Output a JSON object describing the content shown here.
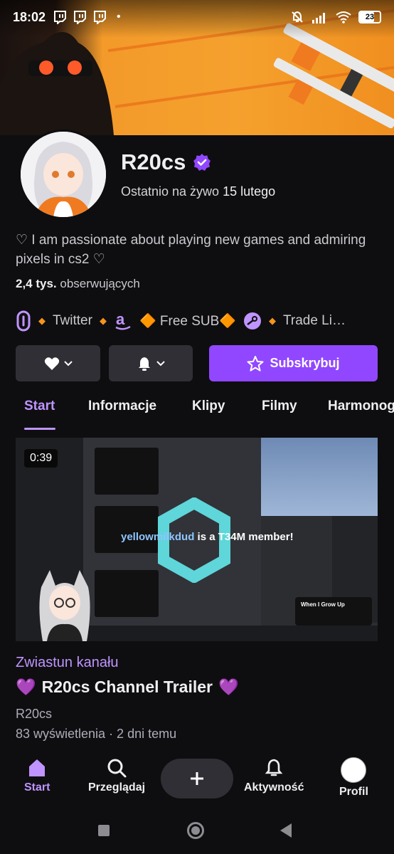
{
  "status_bar": {
    "time": "18:02",
    "battery": "23"
  },
  "channel": {
    "name": "R20cs",
    "last_live_prefix": "Ostatnio na żywo",
    "last_live_date": "15 lutego",
    "bio": "♡ I am passionate about playing new games and admiring pixels in cs2 ♡",
    "followers_count": "2,4 tys.",
    "followers_label": "obserwujących"
  },
  "links": [
    {
      "label": "Twitter",
      "icon": "link-icon"
    },
    {
      "label": "🔶 Free SUB🔶",
      "icon": "amazon-icon"
    },
    {
      "label": "Trade Li…",
      "icon": "steam-icon"
    }
  ],
  "actions": {
    "subscribe_label": "Subskrybuj"
  },
  "tabs": [
    "Start",
    "Informacje",
    "Klipy",
    "Filmy",
    "Harmonog"
  ],
  "video": {
    "duration": "0:39",
    "overlay_user": "yellowmilkdud",
    "overlay_text": "is a T34M member!",
    "now_playing": "When I Grow Up"
  },
  "trailer": {
    "label": "Zwiastun kanału",
    "title_text": "R20cs Channel Trailer",
    "emoji": "💜",
    "channel": "R20cs",
    "meta": "83 wyświetlenia · 2 dni temu"
  },
  "bottom_nav": {
    "start": "Start",
    "browse": "Przeglądaj",
    "activity": "Aktywność",
    "profile": "Profil"
  },
  "colors": {
    "accent": "#9147ff",
    "accent_light": "#bf94ff",
    "background": "#0e0e10",
    "banner_orange": "#f5a12e"
  }
}
